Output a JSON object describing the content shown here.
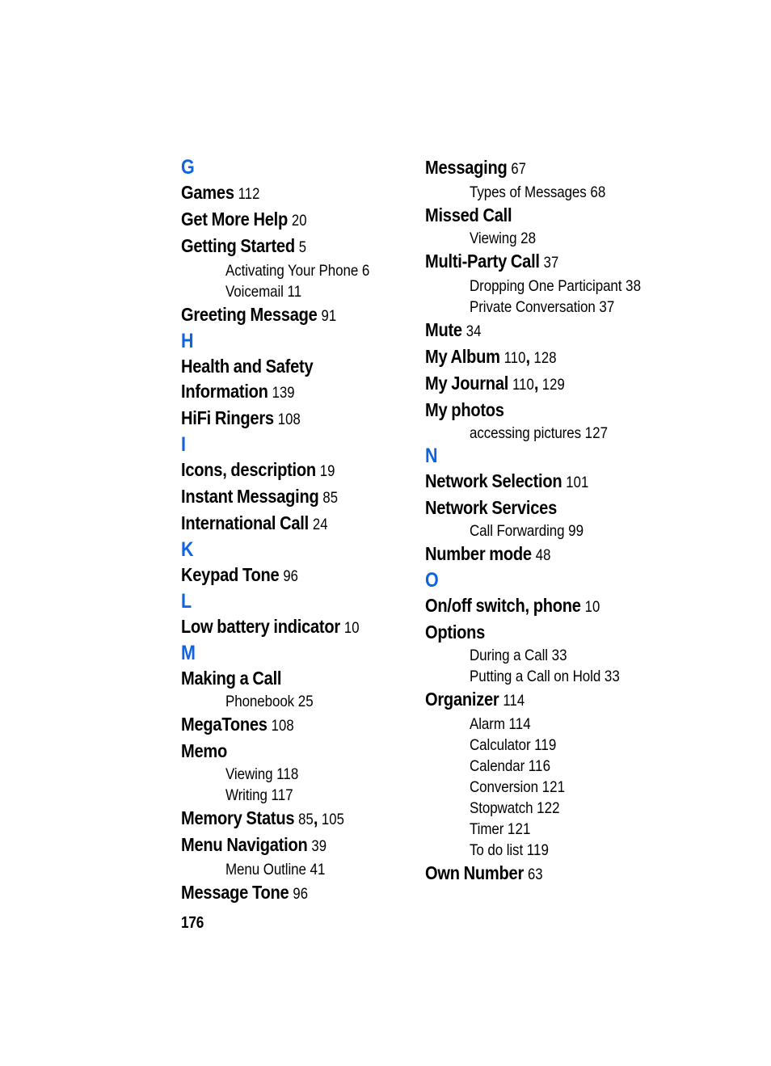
{
  "page": {
    "folio": "176",
    "accent_color": "#0f62e0",
    "text_color": "#000000",
    "background_color": "#ffffff"
  },
  "columns": {
    "left": [
      {
        "kind": "letter",
        "label": "G"
      },
      {
        "kind": "entry",
        "term": "Games",
        "pages": "112"
      },
      {
        "kind": "entry",
        "term": "Get More Help",
        "pages": "20"
      },
      {
        "kind": "entry",
        "term": "Getting Started",
        "pages": "5"
      },
      {
        "kind": "sub",
        "term": "Activating Your Phone",
        "pages": "6"
      },
      {
        "kind": "sub",
        "term": "Voicemail",
        "pages": "11"
      },
      {
        "kind": "entry",
        "term": "Greeting Message",
        "pages": "91"
      },
      {
        "kind": "letter",
        "label": "H"
      },
      {
        "kind": "entry",
        "term": "Health and Safety Information",
        "pages": "139"
      },
      {
        "kind": "entry",
        "term": "HiFi Ringers",
        "pages": "108"
      },
      {
        "kind": "letter",
        "label": "I"
      },
      {
        "kind": "entry",
        "term": "Icons, description",
        "pages": "19"
      },
      {
        "kind": "entry",
        "term": "Instant Messaging",
        "pages": "85"
      },
      {
        "kind": "entry",
        "term": "International Call",
        "pages": "24"
      },
      {
        "kind": "letter",
        "label": "K"
      },
      {
        "kind": "entry",
        "term": "Keypad Tone",
        "pages": "96"
      },
      {
        "kind": "letter",
        "label": "L"
      },
      {
        "kind": "entry",
        "term": "Low battery indicator",
        "pages": "10"
      },
      {
        "kind": "letter",
        "label": "M"
      },
      {
        "kind": "entry",
        "term": "Making a Call",
        "pages": ""
      },
      {
        "kind": "sub",
        "term": "Phonebook",
        "pages": "25"
      },
      {
        "kind": "entry",
        "term": "MegaTones",
        "pages": "108"
      },
      {
        "kind": "entry",
        "term": "Memo",
        "pages": ""
      },
      {
        "kind": "sub",
        "term": "Viewing",
        "pages": "118"
      },
      {
        "kind": "sub",
        "term": "Writing",
        "pages": "117"
      },
      {
        "kind": "entry",
        "term": "Memory Status",
        "pages": "85, 105"
      },
      {
        "kind": "entry",
        "term": "Menu Navigation",
        "pages": "39"
      },
      {
        "kind": "sub",
        "term": "Menu Outline",
        "pages": "41"
      },
      {
        "kind": "entry",
        "term": "Message Tone",
        "pages": "96"
      }
    ],
    "right": [
      {
        "kind": "entry",
        "term": "Messaging",
        "pages": "67"
      },
      {
        "kind": "sub",
        "term": "Types of Messages",
        "pages": "68"
      },
      {
        "kind": "entry",
        "term": "Missed Call",
        "pages": ""
      },
      {
        "kind": "sub",
        "term": "Viewing",
        "pages": "28"
      },
      {
        "kind": "entry",
        "term": "Multi-Party Call",
        "pages": "37"
      },
      {
        "kind": "sub",
        "term": "Dropping One Participant",
        "pages": "38"
      },
      {
        "kind": "sub",
        "term": "Private Conversation",
        "pages": "37"
      },
      {
        "kind": "entry",
        "term": "Mute",
        "pages": "34"
      },
      {
        "kind": "entry",
        "term": "My Album",
        "pages": "110, 128"
      },
      {
        "kind": "entry",
        "term": "My Journal",
        "pages": "110, 129"
      },
      {
        "kind": "entry",
        "term": "My photos",
        "pages": ""
      },
      {
        "kind": "sub",
        "term": "accessing pictures",
        "pages": "127"
      },
      {
        "kind": "letter",
        "label": "N"
      },
      {
        "kind": "entry",
        "term": "Network Selection",
        "pages": "101"
      },
      {
        "kind": "entry",
        "term": "Network Services",
        "pages": ""
      },
      {
        "kind": "sub",
        "term": "Call Forwarding",
        "pages": "99"
      },
      {
        "kind": "entry",
        "term": "Number mode",
        "pages": "48"
      },
      {
        "kind": "letter",
        "label": "O"
      },
      {
        "kind": "entry",
        "term": "On/off switch, phone",
        "pages": "10"
      },
      {
        "kind": "entry",
        "term": "Options",
        "pages": ""
      },
      {
        "kind": "sub",
        "term": "During a Call",
        "pages": "33"
      },
      {
        "kind": "sub",
        "term": "Putting a Call on Hold",
        "pages": "33"
      },
      {
        "kind": "entry",
        "term": "Organizer",
        "pages": "114"
      },
      {
        "kind": "sub",
        "term": "Alarm",
        "pages": "114"
      },
      {
        "kind": "sub",
        "term": "Calculator",
        "pages": "119"
      },
      {
        "kind": "sub",
        "term": "Calendar",
        "pages": "116"
      },
      {
        "kind": "sub",
        "term": "Conversion",
        "pages": "121"
      },
      {
        "kind": "sub",
        "term": "Stopwatch",
        "pages": "122"
      },
      {
        "kind": "sub",
        "term": "Timer",
        "pages": "121"
      },
      {
        "kind": "sub",
        "term": "To do list",
        "pages": "119"
      },
      {
        "kind": "entry",
        "term": "Own Number",
        "pages": "63"
      }
    ]
  }
}
